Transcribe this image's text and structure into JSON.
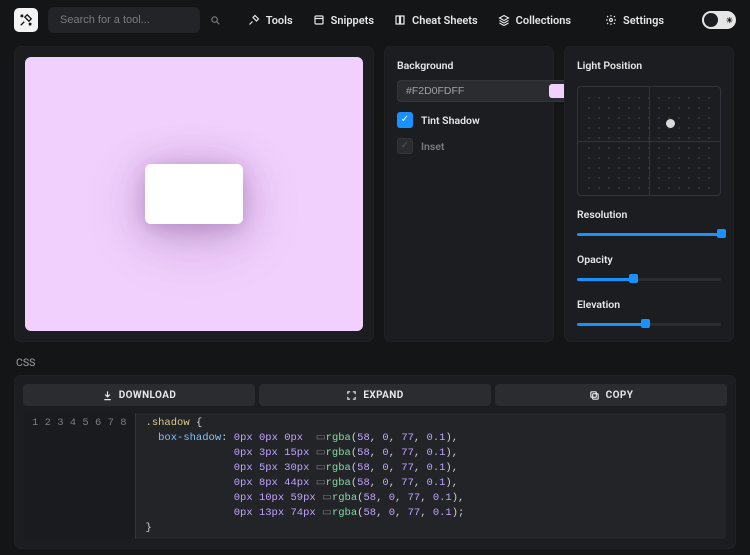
{
  "search": {
    "placeholder": "Search for a tool..."
  },
  "nav": {
    "tools": "Tools",
    "snippets": "Snippets",
    "cheat": "Cheat Sheets",
    "collections": "Collections",
    "settings": "Settings"
  },
  "props": {
    "background_label": "Background",
    "background_value": "#F2D0FDFF",
    "tint_label": "Tint Shadow",
    "tint_checked": true,
    "inset_label": "Inset",
    "inset_checked": false
  },
  "light": {
    "title": "Light Position",
    "resolution_label": "Resolution",
    "resolution_pct": 100,
    "opacity_label": "Opacity",
    "opacity_pct": 39,
    "elevation_label": "Elevation",
    "elevation_pct": 47
  },
  "output": {
    "lang": "CSS",
    "download": "DOWNLOAD",
    "expand": "EXPAND",
    "copy": "COPY"
  },
  "code": {
    "selector": ".shadow",
    "prop": "box-shadow",
    "lines": [
      "0px 0px 0px  rgba(58, 0, 77, 0.1),",
      "0px 3px 15px rgba(58, 0, 77, 0.1),",
      "0px 5px 30px rgba(58, 0, 77, 0.1),",
      "0px 8px 44px rgba(58, 0, 77, 0.1),",
      "0px 10px 59px rgba(58, 0, 77, 0.1),",
      "0px 13px 74px rgba(58, 0, 77, 0.1);"
    ]
  }
}
